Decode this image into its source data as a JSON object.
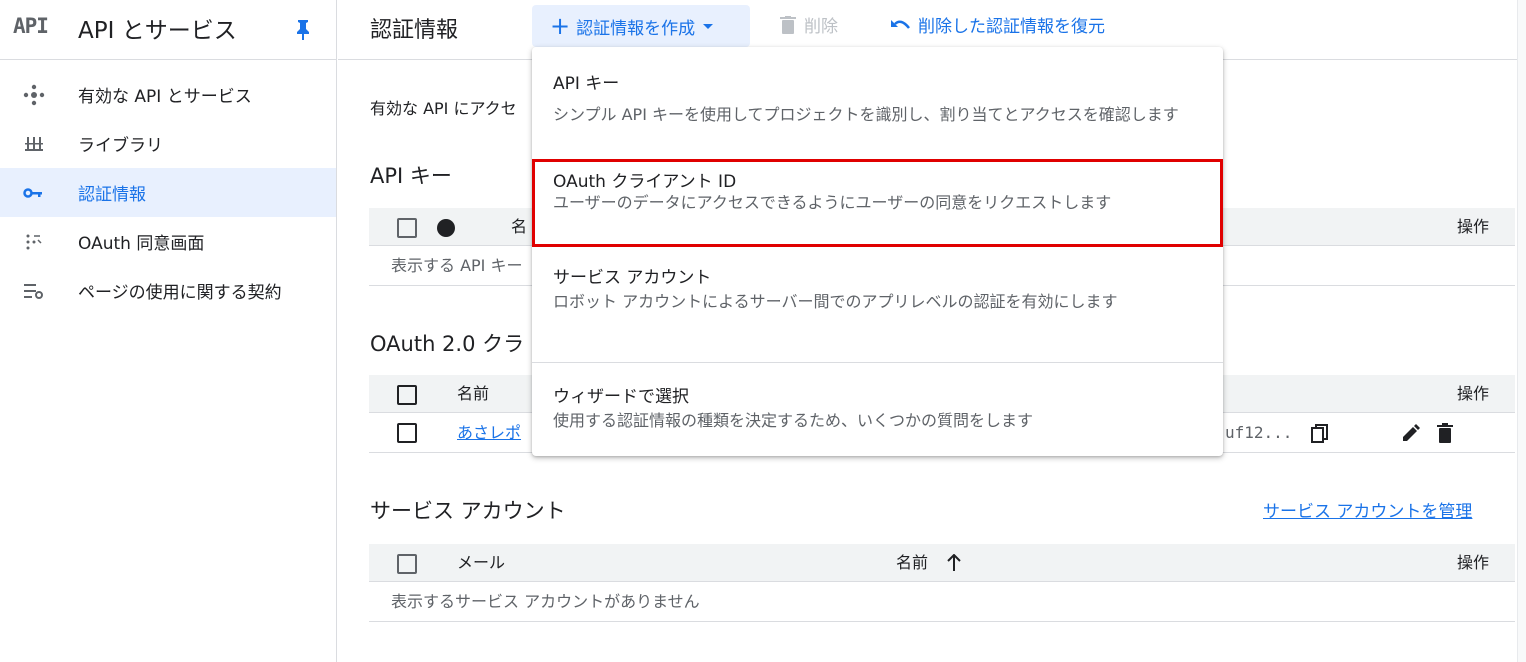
{
  "sidebar": {
    "logo": "API",
    "title": "API とサービス",
    "items": [
      {
        "label": "有効な API とサービス",
        "icon": "api-hub-icon"
      },
      {
        "label": "ライブラリ",
        "icon": "library-icon"
      },
      {
        "label": "認証情報",
        "icon": "key-icon",
        "active": true
      },
      {
        "label": "OAuth 同意画面",
        "icon": "consent-icon"
      },
      {
        "label": "ページの使用に関する契約",
        "icon": "settings-list-icon"
      }
    ]
  },
  "topbar": {
    "title": "認証情報",
    "create_label": "認証情報を作成",
    "delete_label": "削除",
    "restore_label": "削除した認証情報を復元"
  },
  "main": {
    "intro": "有効な API にアクセ",
    "api_keys": {
      "title": "API キー",
      "col_name": "名",
      "col_actions": "操作",
      "empty": "表示する API キー"
    },
    "oauth": {
      "title": "OAuth 2.0 クラ",
      "col_name": "名前",
      "col_actions": "操作",
      "row_name": "あさレポ",
      "row_client_id": "uf12..."
    },
    "service_accounts": {
      "title": "サービス アカウント",
      "manage_link": "サービス アカウントを管理",
      "col_email": "メール",
      "col_name": "名前",
      "col_actions": "操作",
      "empty": "表示するサービス アカウントがありません"
    }
  },
  "menu": {
    "items": [
      {
        "title": "API キー",
        "desc": "シンプル API キーを使用してプロジェクトを識別し、割り当てとアクセスを確認します"
      },
      {
        "title": "OAuth クライアント ID",
        "desc": "ユーザーのデータにアクセスできるようにユーザーの同意をリクエストします",
        "highlighted": true
      },
      {
        "title": "サービス アカウント",
        "desc": "ロボット アカウントによるサーバー間でのアプリレベルの認証を有効にします"
      },
      {
        "title": "ウィザードで選択",
        "desc": "使用する認証情報の種類を決定するため、いくつかの質問をします"
      }
    ]
  },
  "colors": {
    "accent": "#1a73e8",
    "highlight_border": "#e00000",
    "active_bg": "#e8f0fe"
  }
}
